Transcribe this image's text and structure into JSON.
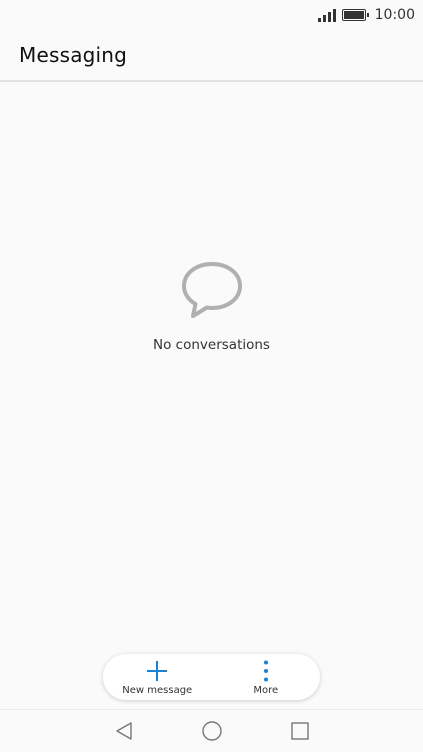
{
  "status_bar": {
    "time": "10:00"
  },
  "header": {
    "title": "Messaging"
  },
  "empty_state": {
    "icon": "chat-bubble-icon",
    "text": "No conversations"
  },
  "actions": {
    "new_message_label": "New message",
    "more_label": "More",
    "accent_color": "#1a82d6"
  },
  "nav": {
    "back_icon": "back-triangle-icon",
    "home_icon": "home-circle-icon",
    "recents_icon": "recents-square-icon"
  }
}
